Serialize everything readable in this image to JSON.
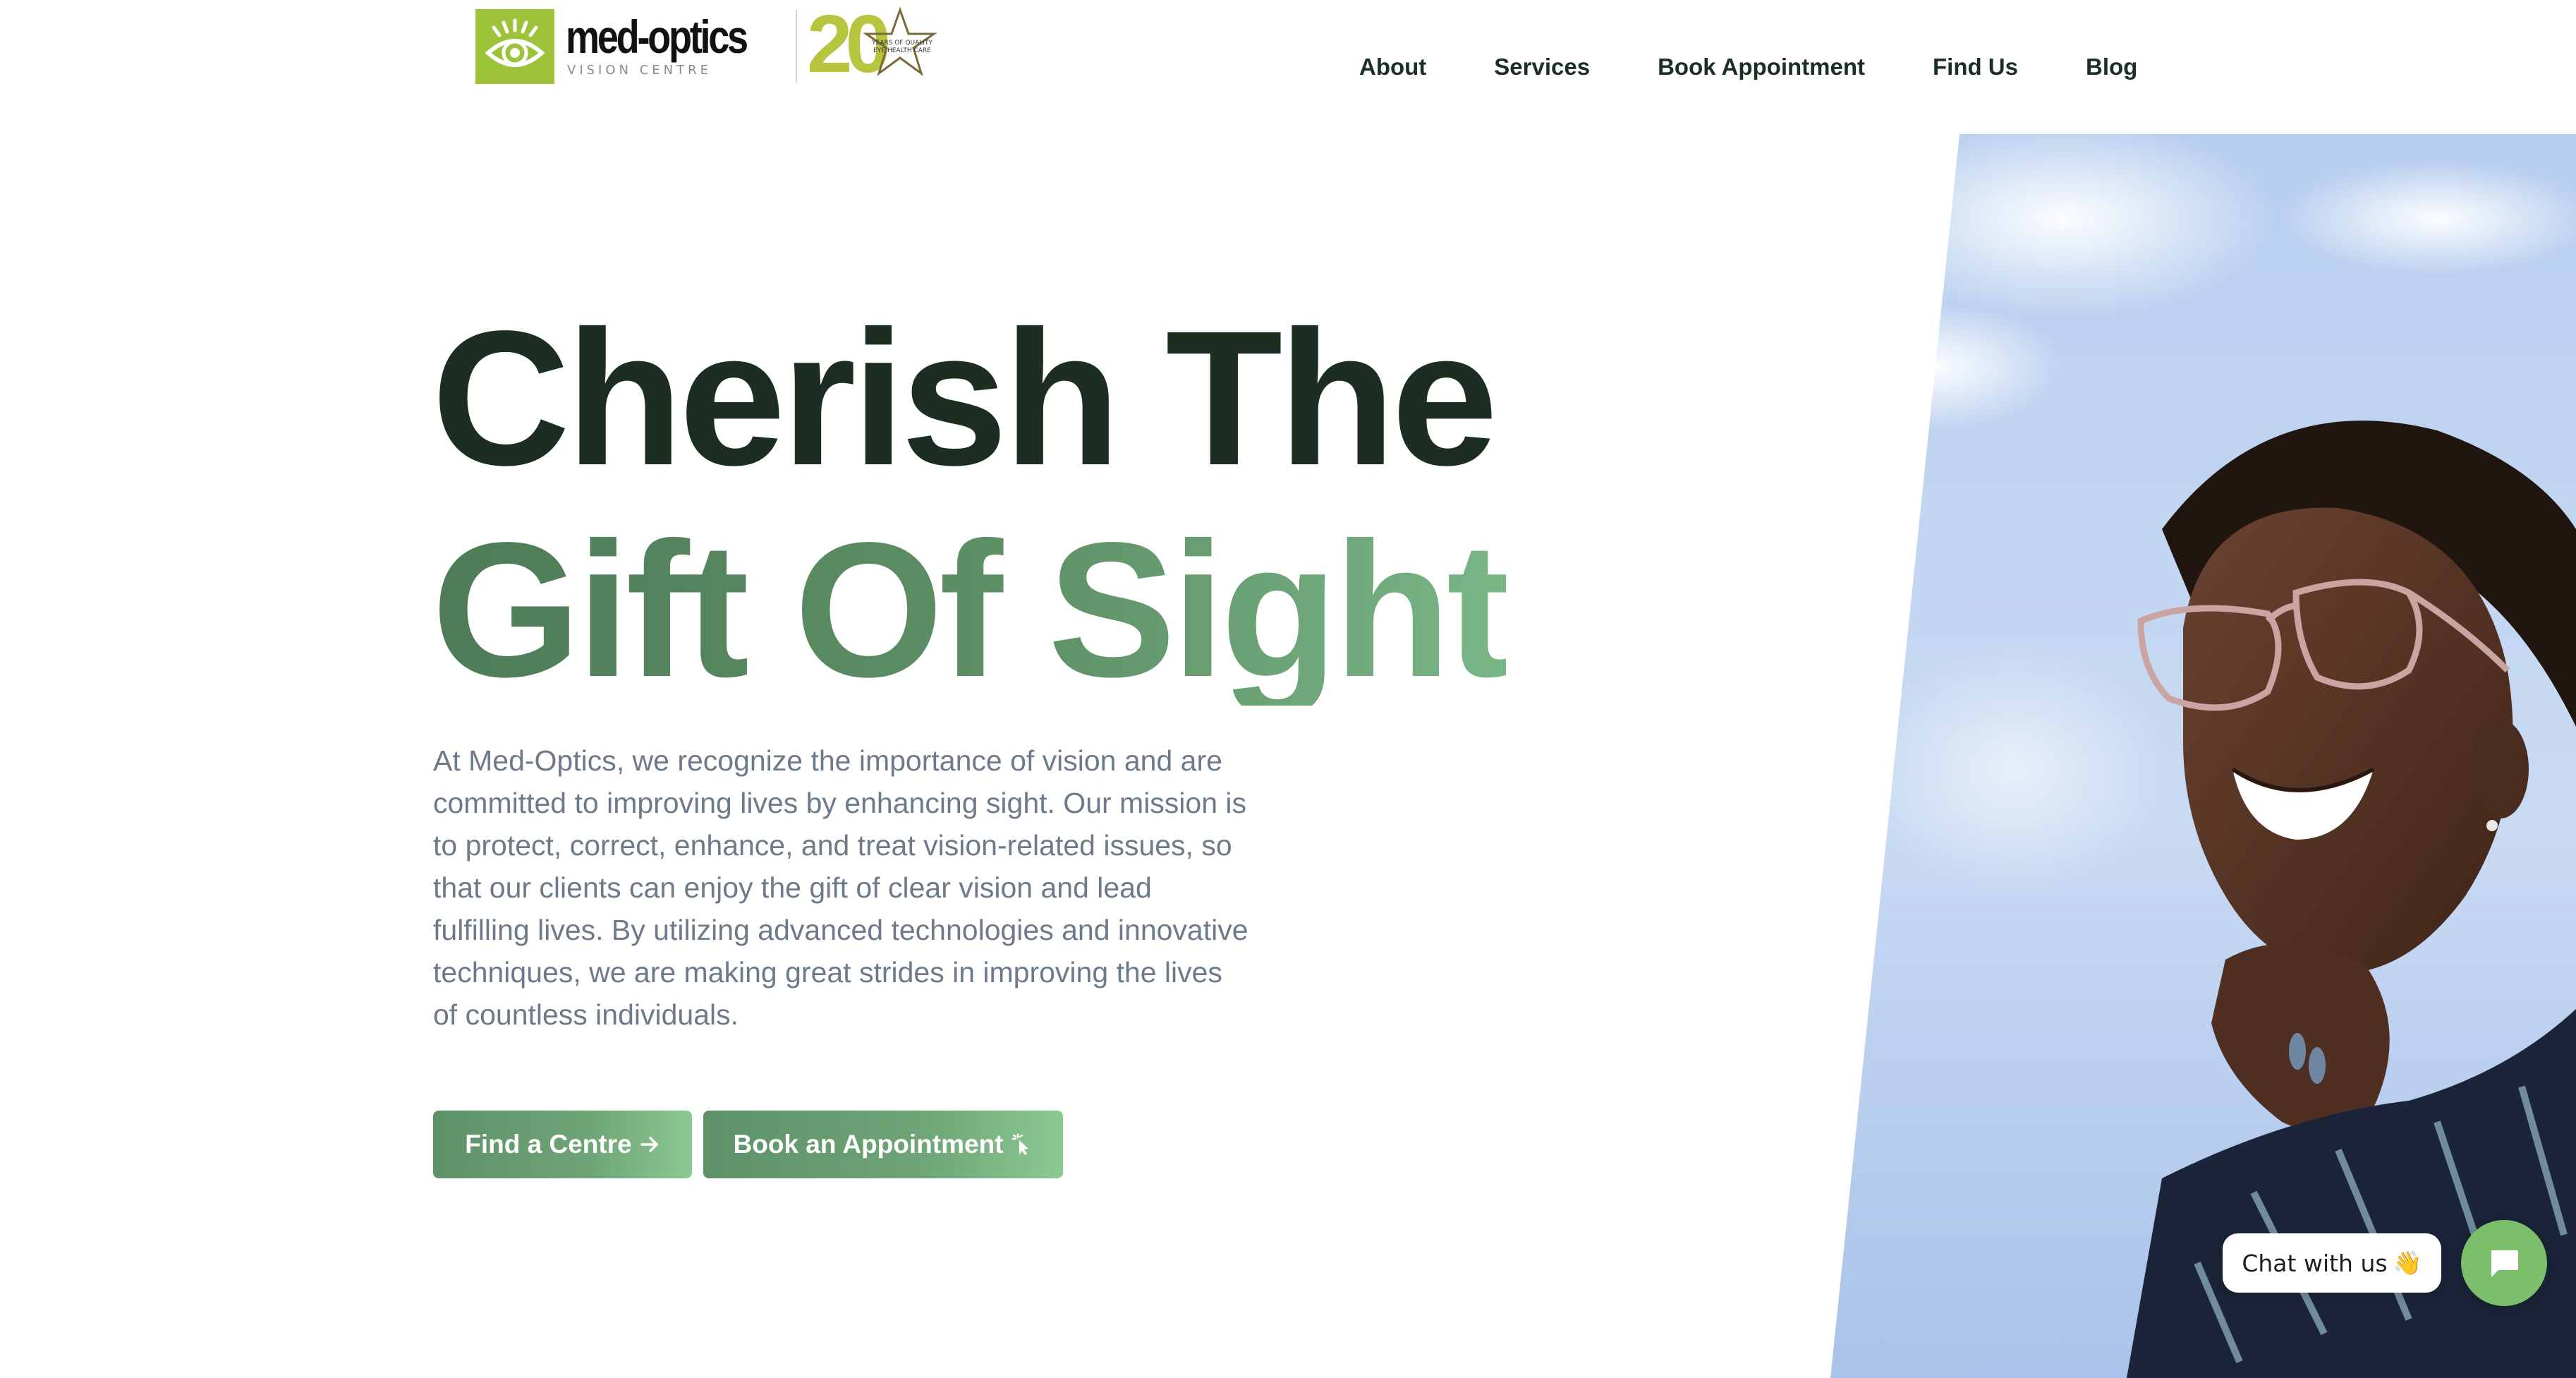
{
  "header": {
    "brand_name": "med-optics",
    "brand_tagline": "VISION CENTRE",
    "anniversary_number": "20",
    "anniversary_text": "YEARS OF QUALITY EYE HEALTH CARE"
  },
  "nav": {
    "items": [
      {
        "label": "About"
      },
      {
        "label": "Services"
      },
      {
        "label": "Book Appointment"
      },
      {
        "label": "Find Us"
      },
      {
        "label": "Blog"
      }
    ]
  },
  "hero": {
    "headline_line1": "Cherish The",
    "headline_line2": "Gift Of Sight",
    "paragraph": "At Med-Optics, we recognize the importance of vision and are committed to improving lives by enhancing sight. Our mission is to protect, correct, enhance, and treat vision-related issues, so that our clients can enjoy the gift of clear vision and lead fulfilling lives. By utilizing advanced technologies and innovative techniques, we are making great strides in improving the lives of countless individuals.",
    "primary_button": {
      "label": "Find a Centre",
      "icon": "arrow-right-icon"
    },
    "secondary_button": {
      "label": "Book an Appointment",
      "icon": "pointer-click-icon"
    }
  },
  "chat": {
    "label": "Chat with us",
    "emoji": "👋",
    "icon": "chat-bubble-icon"
  },
  "colors": {
    "heading_dark": "#1c2e21",
    "heading_green": "#5e9066",
    "paragraph": "#6c7a8a",
    "button": "#6ea476",
    "logo_green": "#9cc33a",
    "chat_green": "#7bbf6a"
  }
}
